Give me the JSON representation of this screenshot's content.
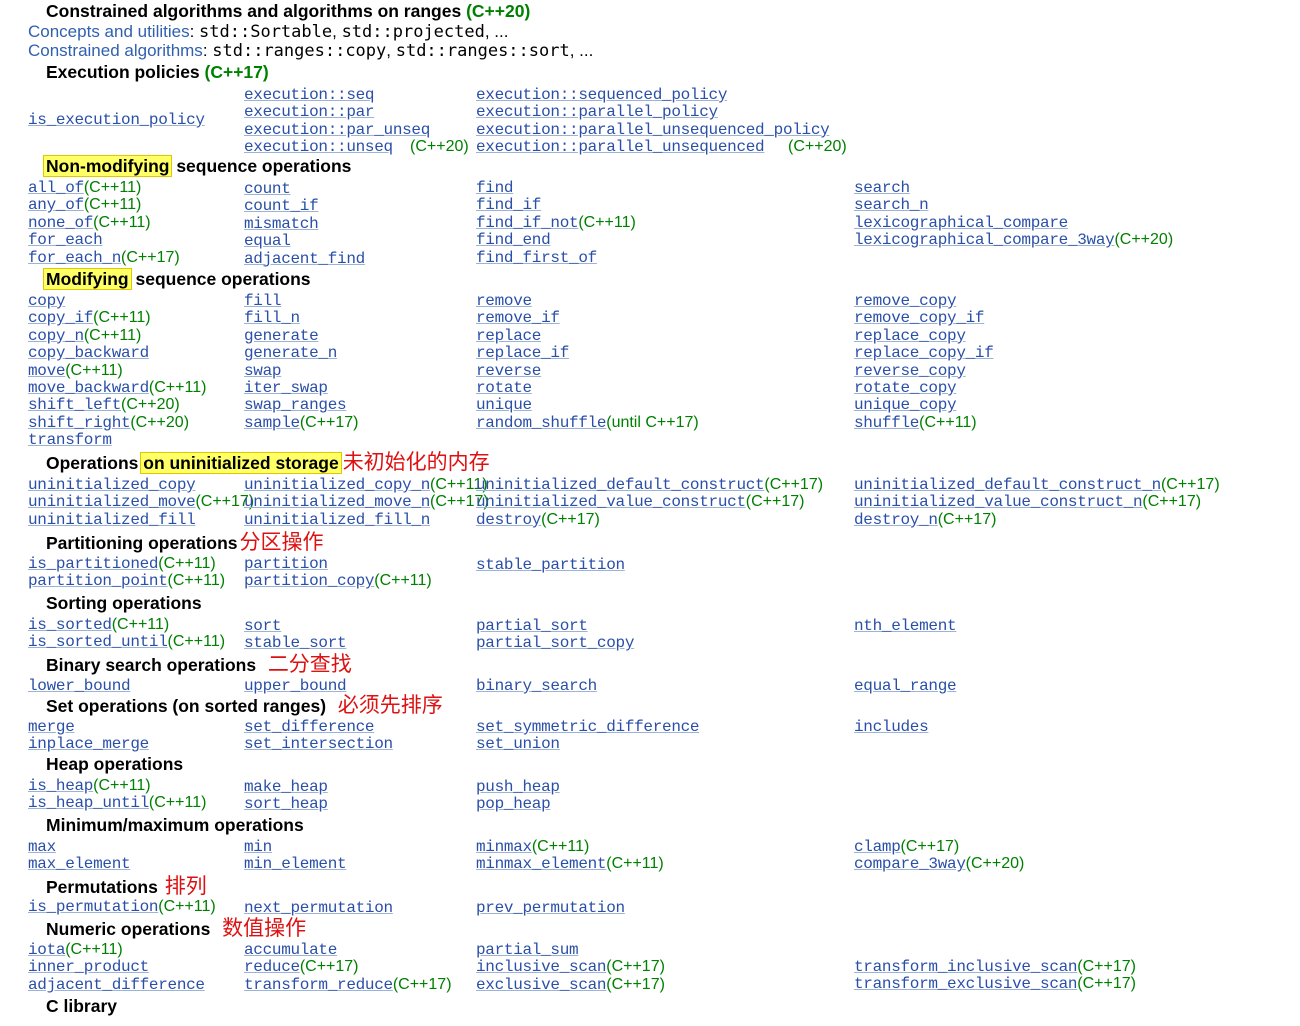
{
  "top_header": {
    "title": "Constrained algorithms and algorithms on ranges",
    "version": "(C++20)"
  },
  "concepts_line": {
    "label": "Concepts and utilities",
    "sep": ": ",
    "code1": "std::Sortable",
    "comma": ", ",
    "code2": "std::projected",
    "tail": ", ..."
  },
  "constrained_line": {
    "label": "Constrained algorithms",
    "sep": ": ",
    "code1": "std::ranges::copy",
    "comma": ", ",
    "code2": "std::ranges::sort",
    "tail": ", ..."
  },
  "exec_header": {
    "title": "Execution policies",
    "version": "(C++17)"
  },
  "nonmod_header": {
    "highlight": "Non-modifying",
    "rest": " sequence operations"
  },
  "mod_header": {
    "highlight": "Modifying",
    "rest": " sequence operations"
  },
  "uninit_header": {
    "pre": "Operations ",
    "highlight": "on uninitialized storage",
    "zh": "未初始化的内存"
  },
  "part_header": {
    "title": "Partitioning operations",
    "zh": "分区操作"
  },
  "sort_header": {
    "title": "Sorting operations"
  },
  "binsearch_header": {
    "title": "Binary search operations",
    "zh": "二分查找"
  },
  "set_header": {
    "title": "Set operations (on sorted ranges)",
    "zh": "必须先排序"
  },
  "heap_header": {
    "title": "Heap operations"
  },
  "minmax_header": {
    "title": "Minimum/maximum operations"
  },
  "perm_header": {
    "title": "Permutations",
    "zh": "排列"
  },
  "numeric_header": {
    "title": "Numeric operations",
    "zh": "数值操作"
  },
  "clib_header": {
    "title": "C library"
  },
  "items": [
    [
      "is_execution_policy",
      ""
    ],
    [
      "execution::seq",
      ""
    ],
    [
      "execution::par",
      ""
    ],
    [
      "execution::par_unseq",
      ""
    ],
    [
      "execution::unseq",
      "(C++20)"
    ],
    [
      "execution::sequenced_policy",
      ""
    ],
    [
      "execution::parallel_policy",
      ""
    ],
    [
      "execution::parallel_unsequenced_policy",
      ""
    ],
    [
      "execution::parallel_unsequenced",
      "(C++20)"
    ],
    [
      "all_of",
      "(C++11)"
    ],
    [
      "any_of",
      "(C++11)"
    ],
    [
      "none_of",
      "(C++11)"
    ],
    [
      "for_each",
      ""
    ],
    [
      "for_each_n",
      "(C++17)"
    ],
    [
      "count",
      ""
    ],
    [
      "count_if",
      ""
    ],
    [
      "mismatch",
      ""
    ],
    [
      "equal",
      ""
    ],
    [
      "adjacent_find",
      ""
    ],
    [
      "find",
      ""
    ],
    [
      "find_if",
      ""
    ],
    [
      "find_if_not",
      "(C++11)"
    ],
    [
      "find_end",
      ""
    ],
    [
      "find_first_of",
      ""
    ],
    [
      "search",
      ""
    ],
    [
      "search_n",
      ""
    ],
    [
      "lexicographical_compare",
      ""
    ],
    [
      "lexicographical_compare_3way",
      "(C++20)"
    ],
    [
      "copy",
      ""
    ],
    [
      "copy_if",
      "(C++11)"
    ],
    [
      "copy_n",
      "(C++11)"
    ],
    [
      "copy_backward",
      ""
    ],
    [
      "move",
      "(C++11)"
    ],
    [
      "move_backward",
      "(C++11)"
    ],
    [
      "shift_left",
      "(C++20)"
    ],
    [
      "shift_right",
      "(C++20)"
    ],
    [
      "transform",
      ""
    ],
    [
      "fill",
      ""
    ],
    [
      "fill_n",
      ""
    ],
    [
      "generate",
      ""
    ],
    [
      "generate_n",
      ""
    ],
    [
      "swap",
      ""
    ],
    [
      "iter_swap",
      ""
    ],
    [
      "swap_ranges",
      ""
    ],
    [
      "sample",
      "(C++17)"
    ],
    [
      "remove",
      ""
    ],
    [
      "remove_if",
      ""
    ],
    [
      "replace",
      ""
    ],
    [
      "replace_if",
      ""
    ],
    [
      "reverse",
      ""
    ],
    [
      "rotate",
      ""
    ],
    [
      "unique",
      ""
    ],
    [
      "random_shuffle",
      "(until C++17)"
    ],
    [
      "remove_copy",
      ""
    ],
    [
      "remove_copy_if",
      ""
    ],
    [
      "replace_copy",
      ""
    ],
    [
      "replace_copy_if",
      ""
    ],
    [
      "reverse_copy",
      ""
    ],
    [
      "rotate_copy",
      ""
    ],
    [
      "unique_copy",
      ""
    ],
    [
      "shuffle",
      "(C++11)"
    ],
    [
      "uninitialized_copy",
      ""
    ],
    [
      "uninitialized_move",
      "(C++17)"
    ],
    [
      "uninitialized_fill",
      ""
    ],
    [
      "uninitialized_copy_n",
      "(C++11)"
    ],
    [
      "uninitialized_move_n",
      "(C++17)"
    ],
    [
      "uninitialized_fill_n",
      ""
    ],
    [
      "uninitialized_default_construct",
      "(C++17)"
    ],
    [
      "uninitialized_value_construct",
      "(C++17)"
    ],
    [
      "destroy",
      "(C++17)"
    ],
    [
      "uninitialized_default_construct_n",
      "(C++17)"
    ],
    [
      "uninitialized_value_construct_n",
      "(C++17)"
    ],
    [
      "destroy_n",
      "(C++17)"
    ],
    [
      "is_partitioned",
      "(C++11)"
    ],
    [
      "partition_point",
      "(C++11)"
    ],
    [
      "partition",
      ""
    ],
    [
      "partition_copy",
      "(C++11)"
    ],
    [
      "stable_partition",
      ""
    ],
    [
      "is_sorted",
      "(C++11)"
    ],
    [
      "is_sorted_until",
      "(C++11)"
    ],
    [
      "sort",
      ""
    ],
    [
      "stable_sort",
      ""
    ],
    [
      "partial_sort",
      ""
    ],
    [
      "partial_sort_copy",
      ""
    ],
    [
      "nth_element",
      ""
    ],
    [
      "lower_bound",
      ""
    ],
    [
      "upper_bound",
      ""
    ],
    [
      "binary_search",
      ""
    ],
    [
      "equal_range",
      ""
    ],
    [
      "merge",
      ""
    ],
    [
      "inplace_merge",
      ""
    ],
    [
      "set_difference",
      ""
    ],
    [
      "set_intersection",
      ""
    ],
    [
      "set_symmetric_difference",
      ""
    ],
    [
      "set_union",
      ""
    ],
    [
      "includes",
      ""
    ],
    [
      "is_heap",
      "(C++11)"
    ],
    [
      "is_heap_until",
      "(C++11)"
    ],
    [
      "make_heap",
      ""
    ],
    [
      "sort_heap",
      ""
    ],
    [
      "push_heap",
      ""
    ],
    [
      "pop_heap",
      ""
    ],
    [
      "max",
      ""
    ],
    [
      "max_element",
      ""
    ],
    [
      "min",
      ""
    ],
    [
      "min_element",
      ""
    ],
    [
      "minmax",
      "(C++11)"
    ],
    [
      "minmax_element",
      "(C++11)"
    ],
    [
      "clamp",
      "(C++17)"
    ],
    [
      "compare_3way",
      "(C++20)"
    ],
    [
      "is_permutation",
      "(C++11)"
    ],
    [
      "next_permutation",
      ""
    ],
    [
      "prev_permutation",
      ""
    ],
    [
      "iota",
      "(C++11)"
    ],
    [
      "inner_product",
      ""
    ],
    [
      "adjacent_difference",
      ""
    ],
    [
      "accumulate",
      ""
    ],
    [
      "reduce",
      "(C++17)"
    ],
    [
      "transform_reduce",
      "(C++17)"
    ],
    [
      "partial_sum",
      ""
    ],
    [
      "inclusive_scan",
      "(C++17)"
    ],
    [
      "exclusive_scan",
      "(C++17)"
    ],
    [
      "transform_inclusive_scan",
      "(C++17)"
    ],
    [
      "transform_exclusive_scan",
      "(C++17)"
    ]
  ]
}
